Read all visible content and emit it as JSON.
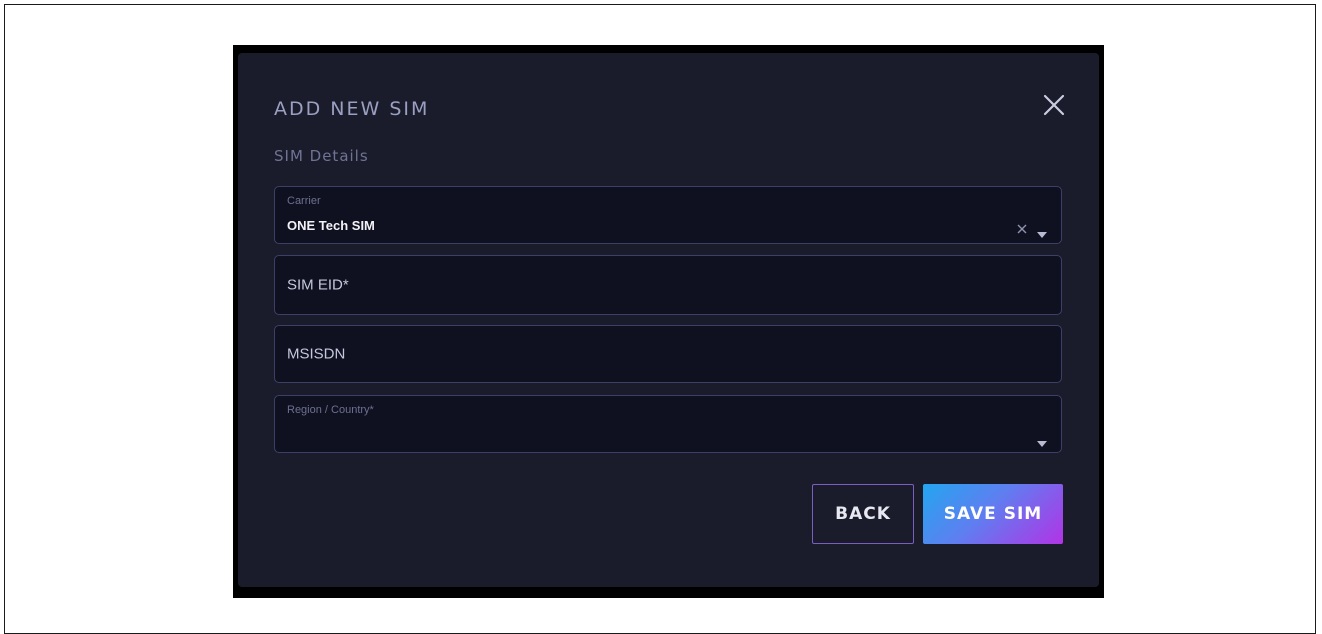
{
  "modal": {
    "title": "ADD NEW SIM",
    "section_label": "SIM Details"
  },
  "fields": {
    "carrier": {
      "label": "Carrier",
      "value": "ONE Tech SIM"
    },
    "sim_eid": {
      "placeholder": "SIM EID*"
    },
    "msisdn": {
      "placeholder": "MSISDN"
    },
    "region": {
      "label": "Region / Country*",
      "value": ""
    }
  },
  "buttons": {
    "back_label": "BACK",
    "save_label": "SAVE SIM"
  },
  "icons": {
    "close": "close-icon",
    "clear": "clear-icon",
    "dropdown": "caret-down-icon"
  },
  "colors": {
    "modal_bg": "#1a1c2c",
    "field_bg": "#0f1120",
    "field_border": "#3d4066",
    "back_border": "#7a5ec0",
    "save_gradient_start": "#23a6f0",
    "save_gradient_end": "#b233e6"
  }
}
